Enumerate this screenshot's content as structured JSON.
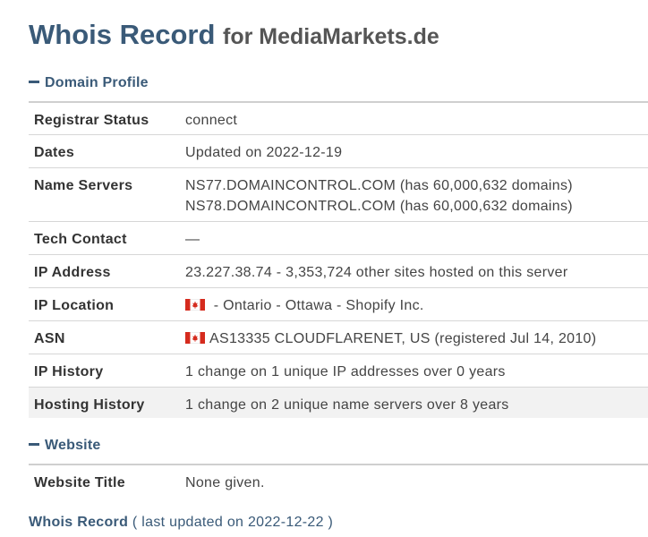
{
  "header": {
    "title_main": "Whois Record",
    "title_for": "for MediaMarkets.de"
  },
  "domain_profile": {
    "heading": "Domain Profile",
    "rows": [
      {
        "label": "Registrar Status",
        "value": "connect"
      },
      {
        "label": "Dates",
        "value": "Updated on 2022-12-19"
      },
      {
        "label": "Name Servers",
        "value": "NS77.DOMAINCONTROL.COM (has 60,000,632 domains)",
        "value2": "NS78.DOMAINCONTROL.COM (has 60,000,632 domains)"
      },
      {
        "label": "Tech Contact",
        "value": "—"
      },
      {
        "label": "IP Address",
        "value": "23.227.38.74 - 3,353,724 other sites hosted on this server"
      },
      {
        "label": "IP Location",
        "flag": "canada-flag-icon",
        "value": " - Ontario - Ottawa - Shopify Inc."
      },
      {
        "label": "ASN",
        "flag": "canada-flag-icon",
        "value": "AS13335 CLOUDFLARENET, US (registered Jul 14, 2010)"
      },
      {
        "label": "IP History",
        "value": "1 change on 1 unique IP addresses over 0 years"
      },
      {
        "label": "Hosting History",
        "value": "1 change on 2 unique name servers over 8 years"
      }
    ]
  },
  "website": {
    "heading": "Website",
    "rows": [
      {
        "label": "Website Title",
        "value": "None given."
      }
    ]
  },
  "footer": {
    "title": "Whois Record",
    "updated": "( last updated on 2022-12-22 )"
  },
  "colors": {
    "accent": "#3a5a78",
    "text": "#333333",
    "shaded_row": "#f2f2f2",
    "flag_red": "#d52b1e"
  }
}
